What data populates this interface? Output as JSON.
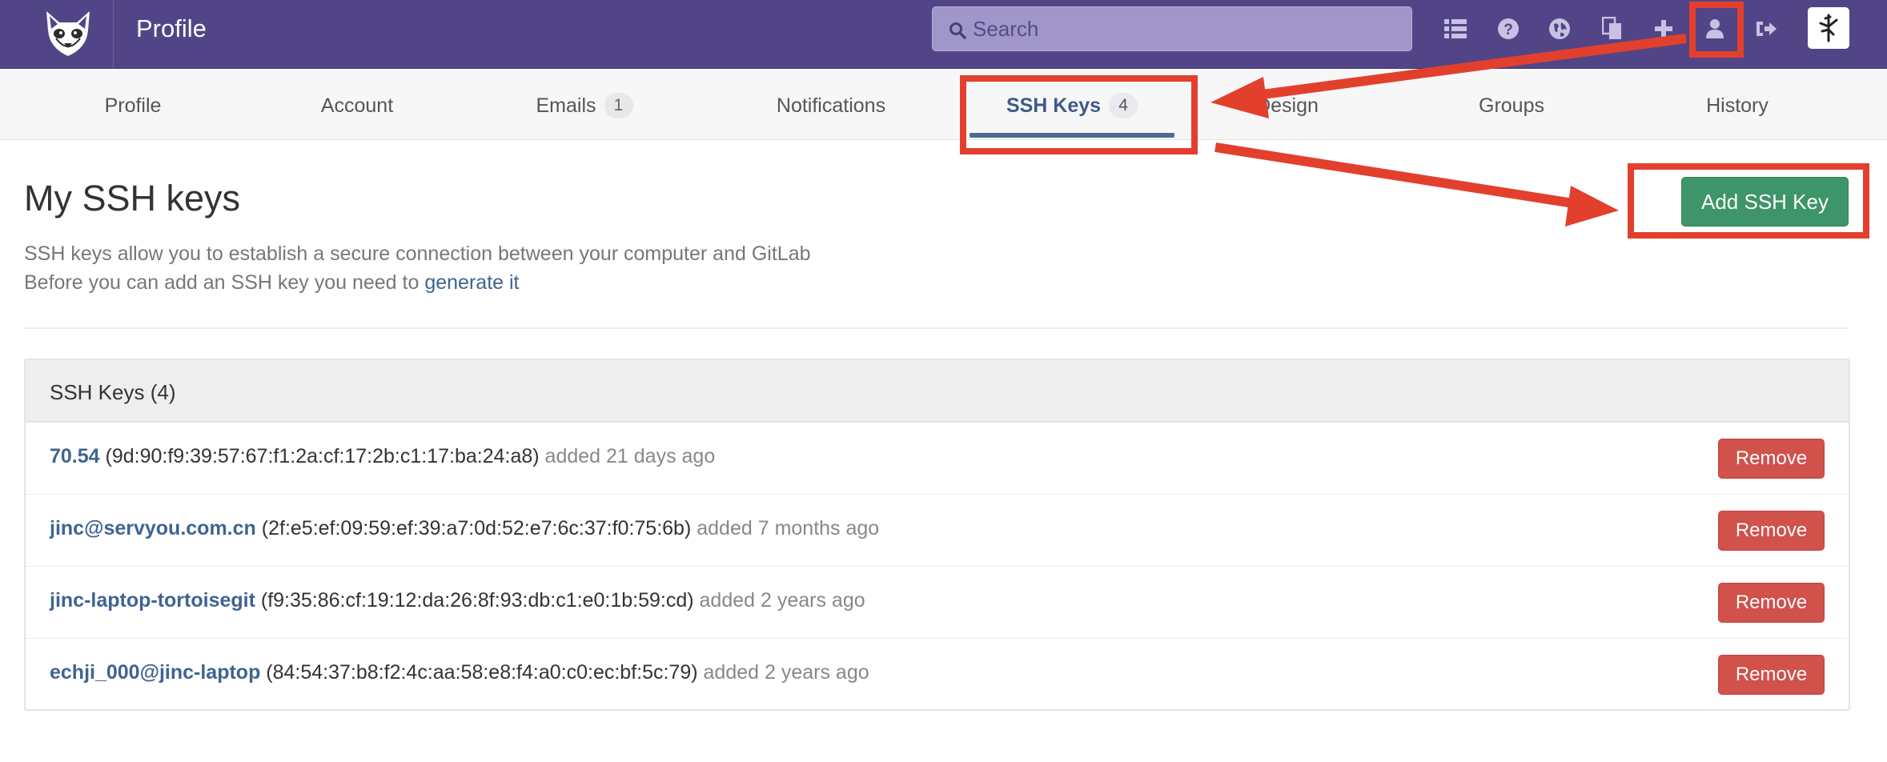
{
  "header": {
    "title": "Profile",
    "search_placeholder": "Search",
    "icons": [
      "list-icon",
      "help-icon",
      "globe-icon",
      "copy-icon",
      "plus-icon",
      "user-icon",
      "sign-out-icon"
    ]
  },
  "tabs": [
    {
      "label": "Profile",
      "badge": ""
    },
    {
      "label": "Account",
      "badge": ""
    },
    {
      "label": "Emails",
      "badge": "1"
    },
    {
      "label": "Notifications",
      "badge": ""
    },
    {
      "label": "SSH Keys",
      "badge": "4",
      "active": true
    },
    {
      "label": "Design",
      "badge": ""
    },
    {
      "label": "Groups",
      "badge": ""
    },
    {
      "label": "History",
      "badge": ""
    }
  ],
  "page": {
    "title": "My SSH keys",
    "add_button": "Add SSH Key",
    "desc_line1": "SSH keys allow you to establish a secure connection between your computer and GitLab",
    "desc_line2_prefix": "Before you can add an SSH key you need to",
    "desc_line2_link": "generate it"
  },
  "keys_panel": {
    "title": "SSH Keys (4)",
    "remove_label": "Remove",
    "keys": [
      {
        "name": "70.54",
        "fingerprint": "(9d:90:f9:39:57:67:f1:2a:cf:17:2b:c1:17:ba:24:a8)",
        "added": "added 21 days ago"
      },
      {
        "name": "jinc@servyou.com.cn",
        "fingerprint": "(2f:e5:ef:09:59:ef:39:a7:0d:52:e7:6c:37:f0:75:6b)",
        "added": "added 7 months ago"
      },
      {
        "name": "jinc-laptop-tortoisegit",
        "fingerprint": "(f9:35:86:cf:19:12:da:26:8f:93:db:c1:e0:1b:59:cd)",
        "added": "added 2 years ago"
      },
      {
        "name": "echji_000@jinc-laptop",
        "fingerprint": "(84:54:37:b8:f2:4c:aa:58:e8:f4:a0:c0:ec:bf:5c:79)",
        "added": "added 2 years ago"
      }
    ]
  },
  "colors": {
    "header_bg": "#524587",
    "tab_active": "#3e5a8a",
    "add_button": "#3e956a",
    "remove_button": "#d1514b",
    "annotation": "#e2402d"
  }
}
